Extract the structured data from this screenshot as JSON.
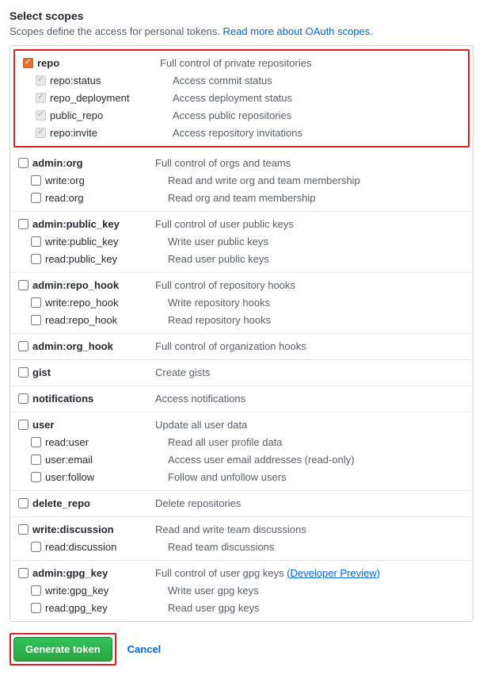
{
  "title": "Select scopes",
  "subtitle_prefix": "Scopes define the access for personal tokens. ",
  "subtitle_link": "Read more about OAuth scopes.",
  "generate_label": "Generate token",
  "cancel_label": "Cancel",
  "preview_label": "(Developer Preview)",
  "groups": [
    {
      "name": "repo",
      "desc": "Full control of private repositories",
      "checked": true,
      "highlighted": true,
      "children": [
        {
          "name": "repo:status",
          "desc": "Access commit status",
          "implied": true
        },
        {
          "name": "repo_deployment",
          "desc": "Access deployment status",
          "implied": true
        },
        {
          "name": "public_repo",
          "desc": "Access public repositories",
          "implied": true
        },
        {
          "name": "repo:invite",
          "desc": "Access repository invitations",
          "implied": true
        }
      ]
    },
    {
      "name": "admin:org",
      "desc": "Full control of orgs and teams",
      "children": [
        {
          "name": "write:org",
          "desc": "Read and write org and team membership"
        },
        {
          "name": "read:org",
          "desc": "Read org and team membership"
        }
      ]
    },
    {
      "name": "admin:public_key",
      "desc": "Full control of user public keys",
      "children": [
        {
          "name": "write:public_key",
          "desc": "Write user public keys"
        },
        {
          "name": "read:public_key",
          "desc": "Read user public keys"
        }
      ]
    },
    {
      "name": "admin:repo_hook",
      "desc": "Full control of repository hooks",
      "children": [
        {
          "name": "write:repo_hook",
          "desc": "Write repository hooks"
        },
        {
          "name": "read:repo_hook",
          "desc": "Read repository hooks"
        }
      ]
    },
    {
      "name": "admin:org_hook",
      "desc": "Full control of organization hooks",
      "children": []
    },
    {
      "name": "gist",
      "desc": "Create gists",
      "children": []
    },
    {
      "name": "notifications",
      "desc": "Access notifications",
      "children": []
    },
    {
      "name": "user",
      "desc": "Update all user data",
      "children": [
        {
          "name": "read:user",
          "desc": "Read all user profile data"
        },
        {
          "name": "user:email",
          "desc": "Access user email addresses (read-only)"
        },
        {
          "name": "user:follow",
          "desc": "Follow and unfollow users"
        }
      ]
    },
    {
      "name": "delete_repo",
      "desc": "Delete repositories",
      "children": []
    },
    {
      "name": "write:discussion",
      "desc": "Read and write team discussions",
      "children": [
        {
          "name": "read:discussion",
          "desc": "Read team discussions"
        }
      ]
    },
    {
      "name": "admin:gpg_key",
      "desc": "Full control of user gpg keys ",
      "preview": true,
      "children": [
        {
          "name": "write:gpg_key",
          "desc": "Write user gpg keys"
        },
        {
          "name": "read:gpg_key",
          "desc": "Read user gpg keys"
        }
      ]
    }
  ]
}
